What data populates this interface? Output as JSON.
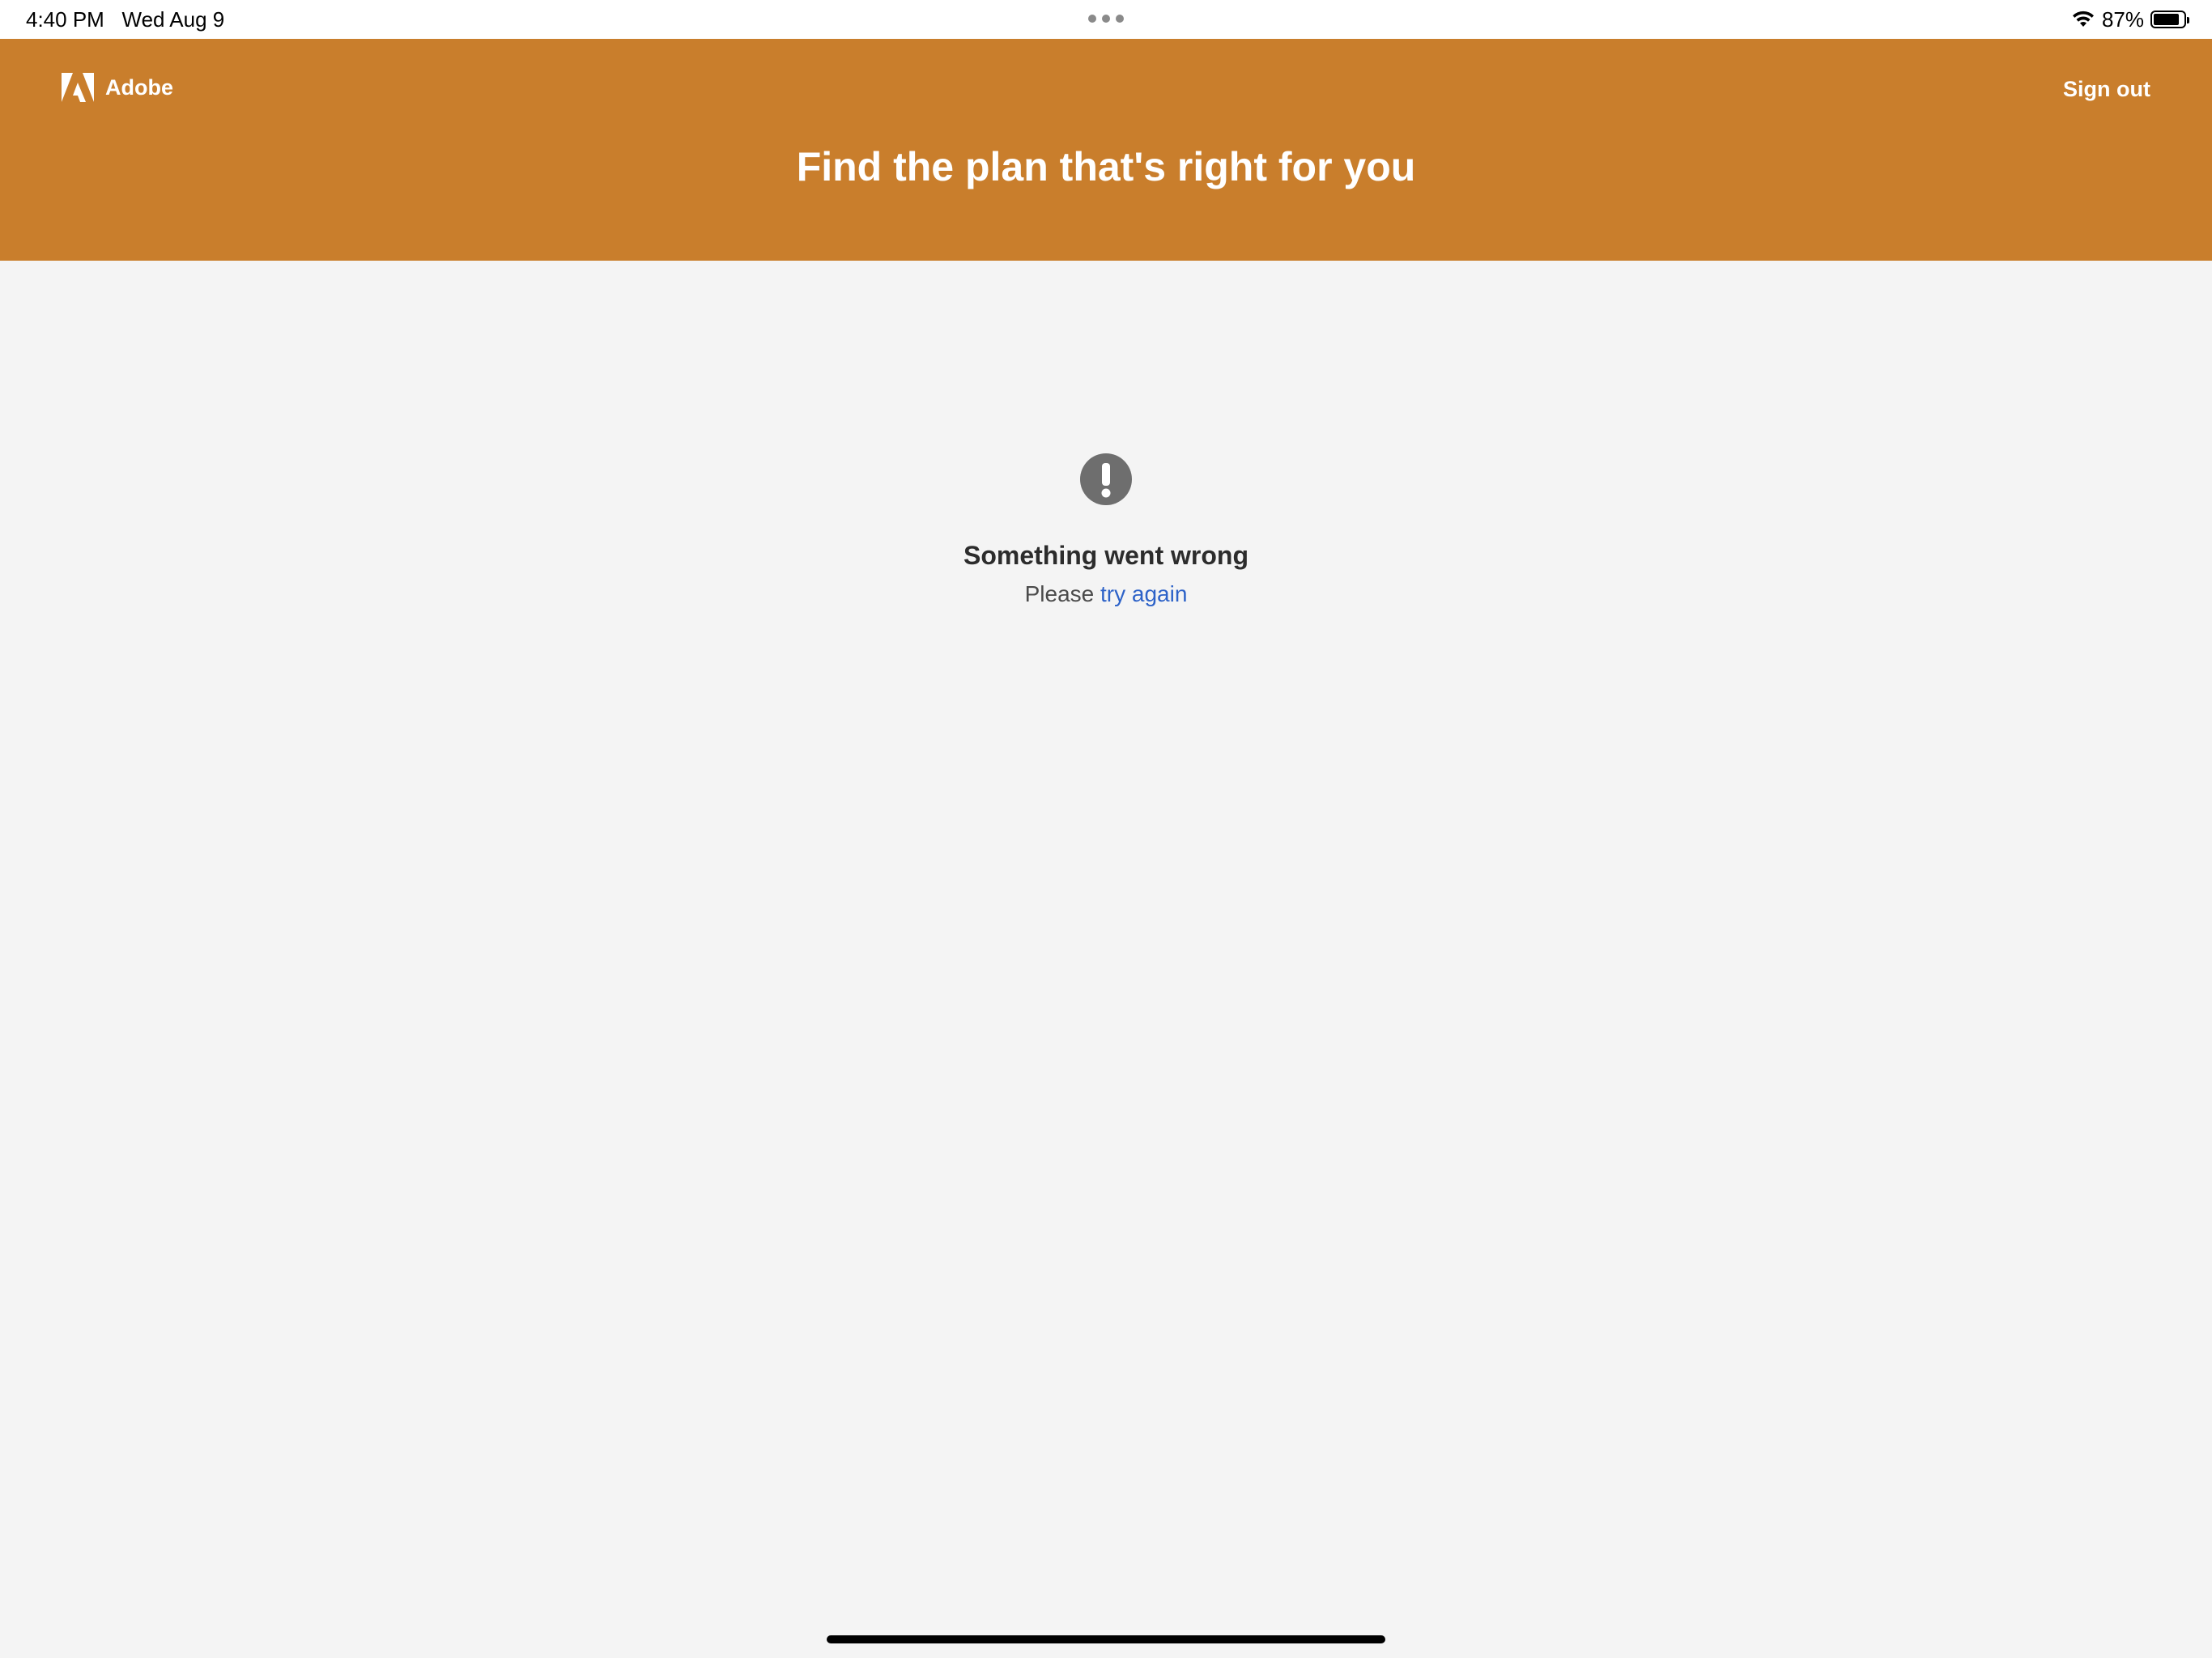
{
  "status_bar": {
    "time": "4:40 PM",
    "date": "Wed Aug 9",
    "battery_percent": "87%",
    "battery_level": 0.87,
    "icons": [
      "more-dots-icon",
      "wifi-icon",
      "battery-icon"
    ]
  },
  "header": {
    "brand": "Adobe",
    "sign_out_label": "Sign out",
    "title": "Find the plan that's right for you",
    "background_color": "#c97e2c"
  },
  "error": {
    "icon": "exclamation-circle-icon",
    "title": "Something went wrong",
    "message_prefix": "Please",
    "link_label": "try again",
    "link_color": "#2d62c8"
  }
}
